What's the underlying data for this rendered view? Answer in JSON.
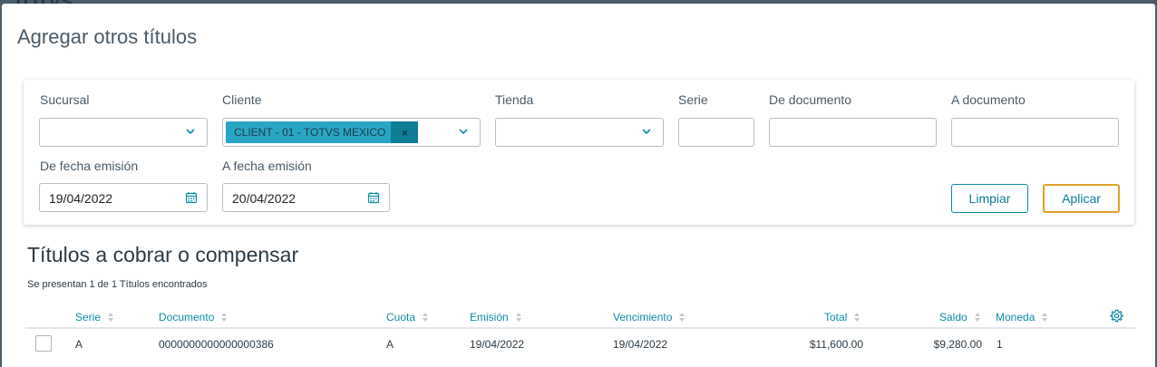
{
  "backdrop": {
    "text": "TOTVS"
  },
  "modal": {
    "title": "Agregar otros títulos",
    "filters": {
      "sucursal_label": "Sucursal",
      "cliente_label": "Cliente",
      "cliente_chip": "CLIENT - 01 - TOTVS MEXICO",
      "chip_remove": "×",
      "tienda_label": "Tienda",
      "serie_label": "Serie",
      "de_documento_label": "De documento",
      "a_documento_label": "A documento",
      "de_fecha_label": "De fecha emisión",
      "de_fecha_value": "19/04/2022",
      "a_fecha_label": "A fecha emisión",
      "a_fecha_value": "20/04/2022",
      "limpiar_label": "Limpiar",
      "aplicar_label": "Aplicar"
    },
    "section_title": "Títulos a cobrar o compensar",
    "count_text": "Se presentan 1 de 1 Títulos encontrados",
    "table": {
      "headers": {
        "serie": "Serie",
        "documento": "Documento",
        "cuota": "Cuota",
        "emision": "Emisión",
        "vencimiento": "Vencimiento",
        "total": "Total",
        "saldo": "Saldo",
        "moneda": "Moneda"
      },
      "rows": [
        {
          "serie": "A",
          "documento": "0000000000000000386",
          "cuota": "A",
          "emision": "19/04/2022",
          "vencimiento": "19/04/2022",
          "total": "$11,600.00",
          "saldo": "$9,280.00",
          "moneda": "1"
        }
      ]
    }
  },
  "colors": {
    "accent": "#0f8aa6",
    "chip": "#29a5c4",
    "chip_close": "#0f7d96",
    "apply_border": "#e0a028"
  },
  "icons": [
    "chevron-down-icon",
    "calendar-icon",
    "close-icon",
    "sort-icon",
    "gear-icon"
  ]
}
